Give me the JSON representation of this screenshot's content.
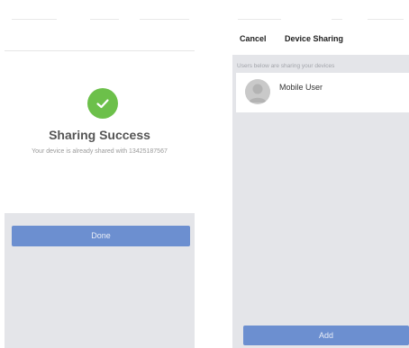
{
  "success_screen": {
    "title": "Sharing Success",
    "description": "Your device is already shared with 13425187567",
    "done_label": "Done"
  },
  "sharing_screen": {
    "cancel_label": "Cancel",
    "title": "Device Sharing",
    "section_label": "Users below are sharing your devices",
    "users": [
      {
        "name": "Mobile User"
      }
    ],
    "add_label": "Add"
  },
  "icons": {
    "success": "check-circle-icon",
    "avatar": "user-avatar-icon"
  },
  "colors": {
    "success_green": "#6cc04a",
    "button_blue": "#6c8fd0",
    "background_gray": "#e4e5e9"
  }
}
